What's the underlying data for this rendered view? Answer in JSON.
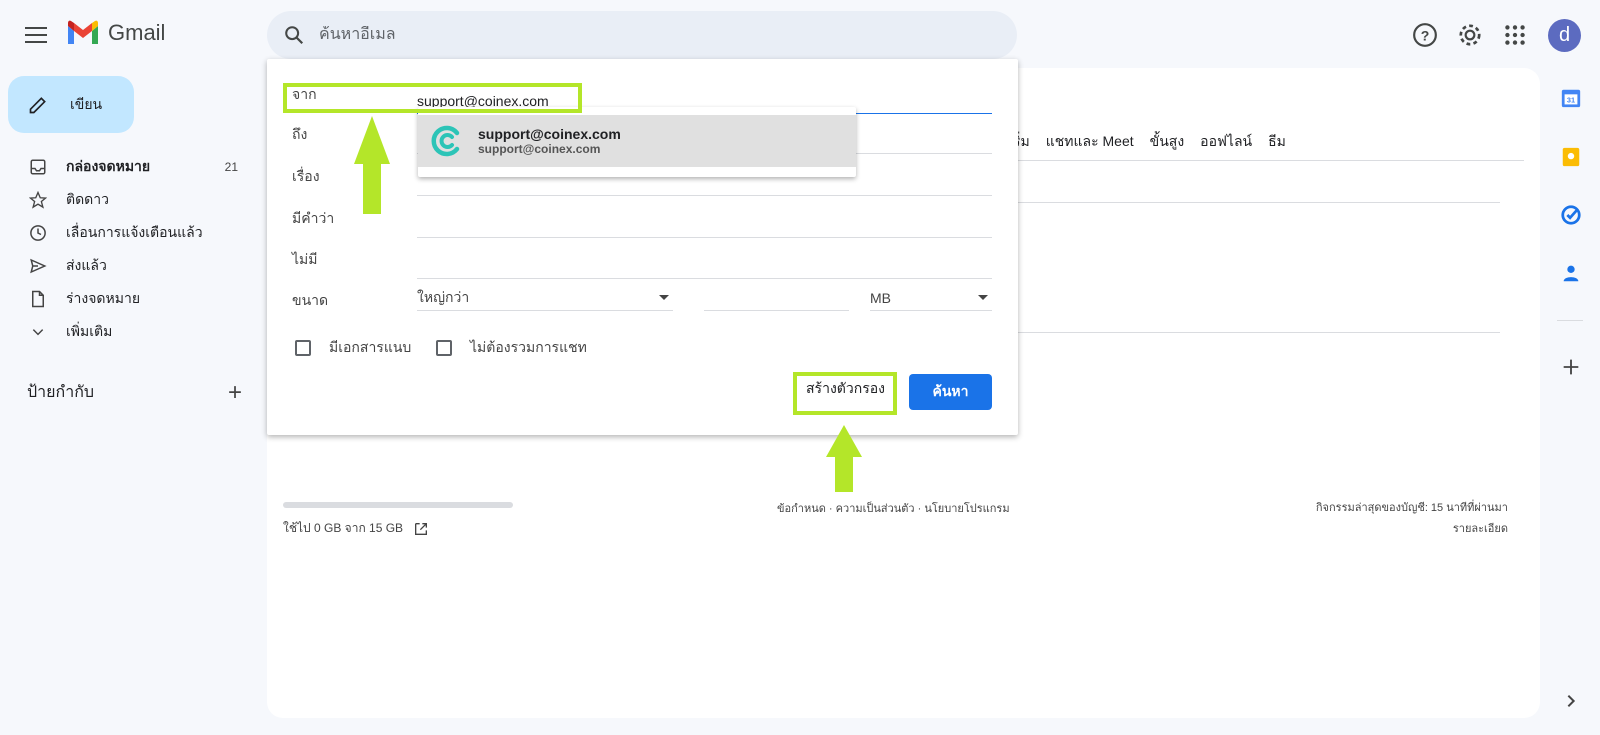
{
  "header": {
    "app_name": "Gmail",
    "search_placeholder": "ค้นหาอีเมล",
    "avatar_letter": "d"
  },
  "sidebar": {
    "compose_label": "เขียน",
    "items": [
      {
        "label": "กล่องจดหมาย",
        "count": "21",
        "icon": "inbox-icon"
      },
      {
        "label": "ติดดาว",
        "icon": "star-icon"
      },
      {
        "label": "เลื่อนการแจ้งเตือนแล้ว",
        "icon": "clock-icon"
      },
      {
        "label": "ส่งแล้ว",
        "icon": "send-icon"
      },
      {
        "label": "ร่างจดหมาย",
        "icon": "draft-icon"
      },
      {
        "label": "เพิ่มเติม",
        "icon": "chevron-down-icon"
      }
    ],
    "labels_title": "ป้ายกำกับ"
  },
  "main": {
    "tabs": [
      "ริ่ม",
      "แชทและ Meet",
      "ขั้นสูง",
      "ออฟไลน์",
      "ธีม"
    ],
    "storage_text": "ใช้ไป 0 GB จาก 15 GB",
    "footer_links": "ข้อกำหนด · ความเป็นส่วนตัว · นโยบายโปรแกรม",
    "activity_line1": "กิจกรรมล่าสุดของบัญชี: 15 นาทีที่ผ่านมา",
    "activity_line2": "รายละเอียด"
  },
  "search_dialog": {
    "from_label": "จาก",
    "from_value": "support@coinex.com",
    "to_label": "ถึง",
    "subject_label": "เรื่อง",
    "has_words_label": "มีคำว่า",
    "doesnt_have_label": "ไม่มี",
    "size_label": "ขนาด",
    "size_operator": "ใหญ่กว่า",
    "size_unit": "MB",
    "has_attachment_label": "มีเอกสารแนบ",
    "exclude_chats_label": "ไม่ต้องรวมการแชท",
    "create_filter_label": "สร้างตัวกรอง",
    "search_button_label": "ค้นหา"
  },
  "autocomplete": {
    "name": "support@coinex.com",
    "email": "support@coinex.com"
  },
  "colors": {
    "highlight": "#b4e629",
    "primary_button": "#1a73e8",
    "compose_bg": "#c2e7ff"
  }
}
